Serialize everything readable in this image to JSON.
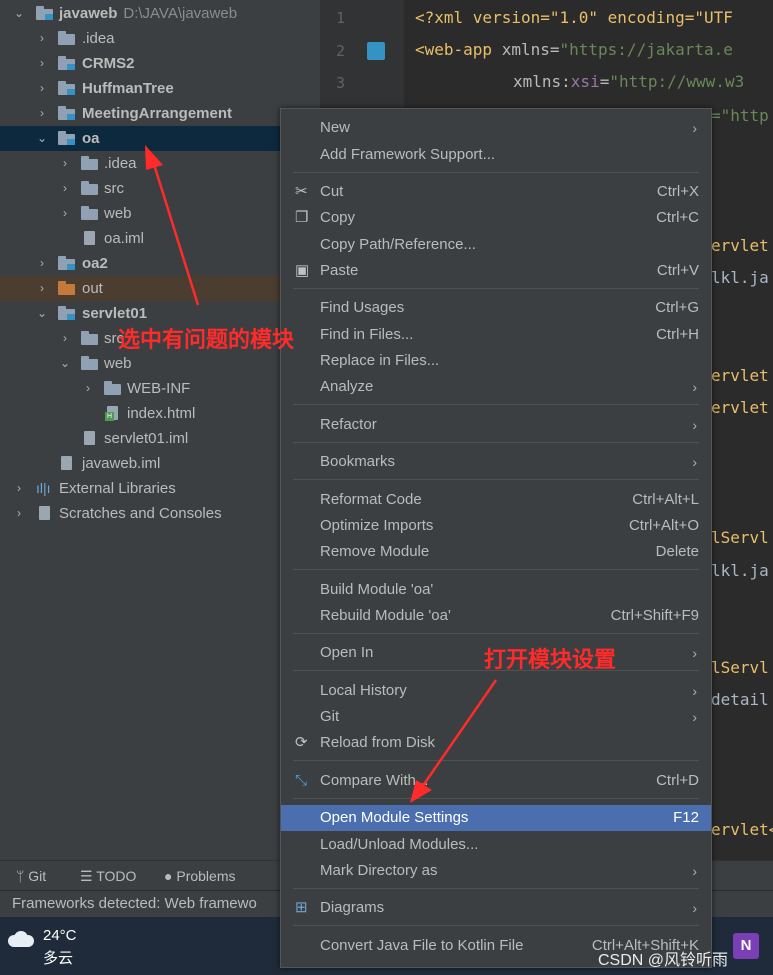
{
  "tree": {
    "root": {
      "label": "javaweb",
      "path": "D:\\JAVA\\javaweb"
    },
    "items": [
      {
        "label": ".idea",
        "bold": false
      },
      {
        "label": "CRMS2",
        "bold": true
      },
      {
        "label": "HuffmanTree",
        "bold": true
      },
      {
        "label": "MeetingArrangement",
        "bold": true
      },
      {
        "label": "oa",
        "bold": true
      },
      {
        "label": ".idea",
        "bold": false
      },
      {
        "label": "src",
        "bold": false
      },
      {
        "label": "web",
        "bold": false
      },
      {
        "label": "oa.iml",
        "bold": false
      },
      {
        "label": "oa2",
        "bold": true
      },
      {
        "label": "out",
        "bold": false
      },
      {
        "label": "servlet01",
        "bold": true
      },
      {
        "label": "src",
        "bold": false
      },
      {
        "label": "web",
        "bold": false
      },
      {
        "label": "WEB-INF",
        "bold": false
      },
      {
        "label": "index.html",
        "bold": false
      },
      {
        "label": "servlet01.iml",
        "bold": false
      },
      {
        "label": "javaweb.iml",
        "bold": false
      },
      {
        "label": "External Libraries",
        "bold": false
      },
      {
        "label": "Scratches and Consoles",
        "bold": false
      }
    ]
  },
  "editor": {
    "line_numbers": [
      "1",
      "2",
      "3"
    ],
    "line1": "<?xml version=\"1.0\" encoding=\"UTF",
    "line2_tag": "<web-app ",
    "line2_attr": "xmlns=",
    "line2_val": "\"https://jakarta.e",
    "line3_attr": "xmlns:",
    "line3_prefix": "xsi",
    "line3_eq": "=",
    "line3_val": "\"http://www.w3",
    "line4_val": "=\"http",
    "fragments": [
      "ervlet",
      "lkl.ja",
      "ervlet",
      "ervlet",
      "lServl",
      "lkl.ja",
      "lServl",
      "detail",
      "ervlet<"
    ]
  },
  "toolbar": {
    "git": "Git",
    "todo": "TODO",
    "problems": "Problems"
  },
  "status": {
    "text": "Frameworks detected: Web framewo"
  },
  "taskbar": {
    "temp": "24°C",
    "desc": "多云"
  },
  "watermark": "CSDN @风铃听雨",
  "menu": {
    "items": [
      {
        "label": "New",
        "shortcut": "",
        "submenu": true
      },
      {
        "label": "Add Framework Support...",
        "shortcut": ""
      },
      {
        "label": "Cut",
        "shortcut": "Ctrl+X",
        "icon": "scissors-icon"
      },
      {
        "label": "Copy",
        "shortcut": "Ctrl+C",
        "icon": "copy-icon"
      },
      {
        "label": "Copy Path/Reference...",
        "shortcut": ""
      },
      {
        "label": "Paste",
        "shortcut": "Ctrl+V",
        "icon": "clipboard-icon"
      },
      {
        "label": "Find Usages",
        "shortcut": "Ctrl+G"
      },
      {
        "label": "Find in Files...",
        "shortcut": "Ctrl+H"
      },
      {
        "label": "Replace in Files...",
        "shortcut": ""
      },
      {
        "label": "Analyze",
        "shortcut": "",
        "submenu": true
      },
      {
        "label": "Refactor",
        "shortcut": "",
        "submenu": true
      },
      {
        "label": "Bookmarks",
        "shortcut": "",
        "submenu": true
      },
      {
        "label": "Reformat Code",
        "shortcut": "Ctrl+Alt+L"
      },
      {
        "label": "Optimize Imports",
        "shortcut": "Ctrl+Alt+O"
      },
      {
        "label": "Remove Module",
        "shortcut": "Delete"
      },
      {
        "label": "Build Module 'oa'",
        "shortcut": ""
      },
      {
        "label": "Rebuild Module 'oa'",
        "shortcut": "Ctrl+Shift+F9"
      },
      {
        "label": "Open In",
        "shortcut": "",
        "submenu": true
      },
      {
        "label": "Local History",
        "shortcut": "",
        "submenu": true
      },
      {
        "label": "Git",
        "shortcut": "",
        "submenu": true
      },
      {
        "label": "Reload from Disk",
        "shortcut": "",
        "icon": "reload-icon"
      },
      {
        "label": "Compare With...",
        "shortcut": "Ctrl+D",
        "icon": "compare-icon"
      },
      {
        "label": "Open Module Settings",
        "shortcut": "F12",
        "highlighted": true
      },
      {
        "label": "Load/Unload Modules...",
        "shortcut": ""
      },
      {
        "label": "Mark Directory as",
        "shortcut": "",
        "submenu": true
      },
      {
        "label": "Diagrams",
        "shortcut": "",
        "submenu": true,
        "icon": "diagram-icon"
      },
      {
        "label": "Convert Java File to Kotlin File",
        "shortcut": "Ctrl+Alt+Shift+K"
      }
    ]
  },
  "annotations": {
    "select_module": "选中有问题的模块",
    "open_settings": "打开模块设置"
  },
  "colors": {
    "annotation": "#ff2a2a",
    "selection": "#0d293e",
    "menu_highlight": "#4b6eaf"
  }
}
